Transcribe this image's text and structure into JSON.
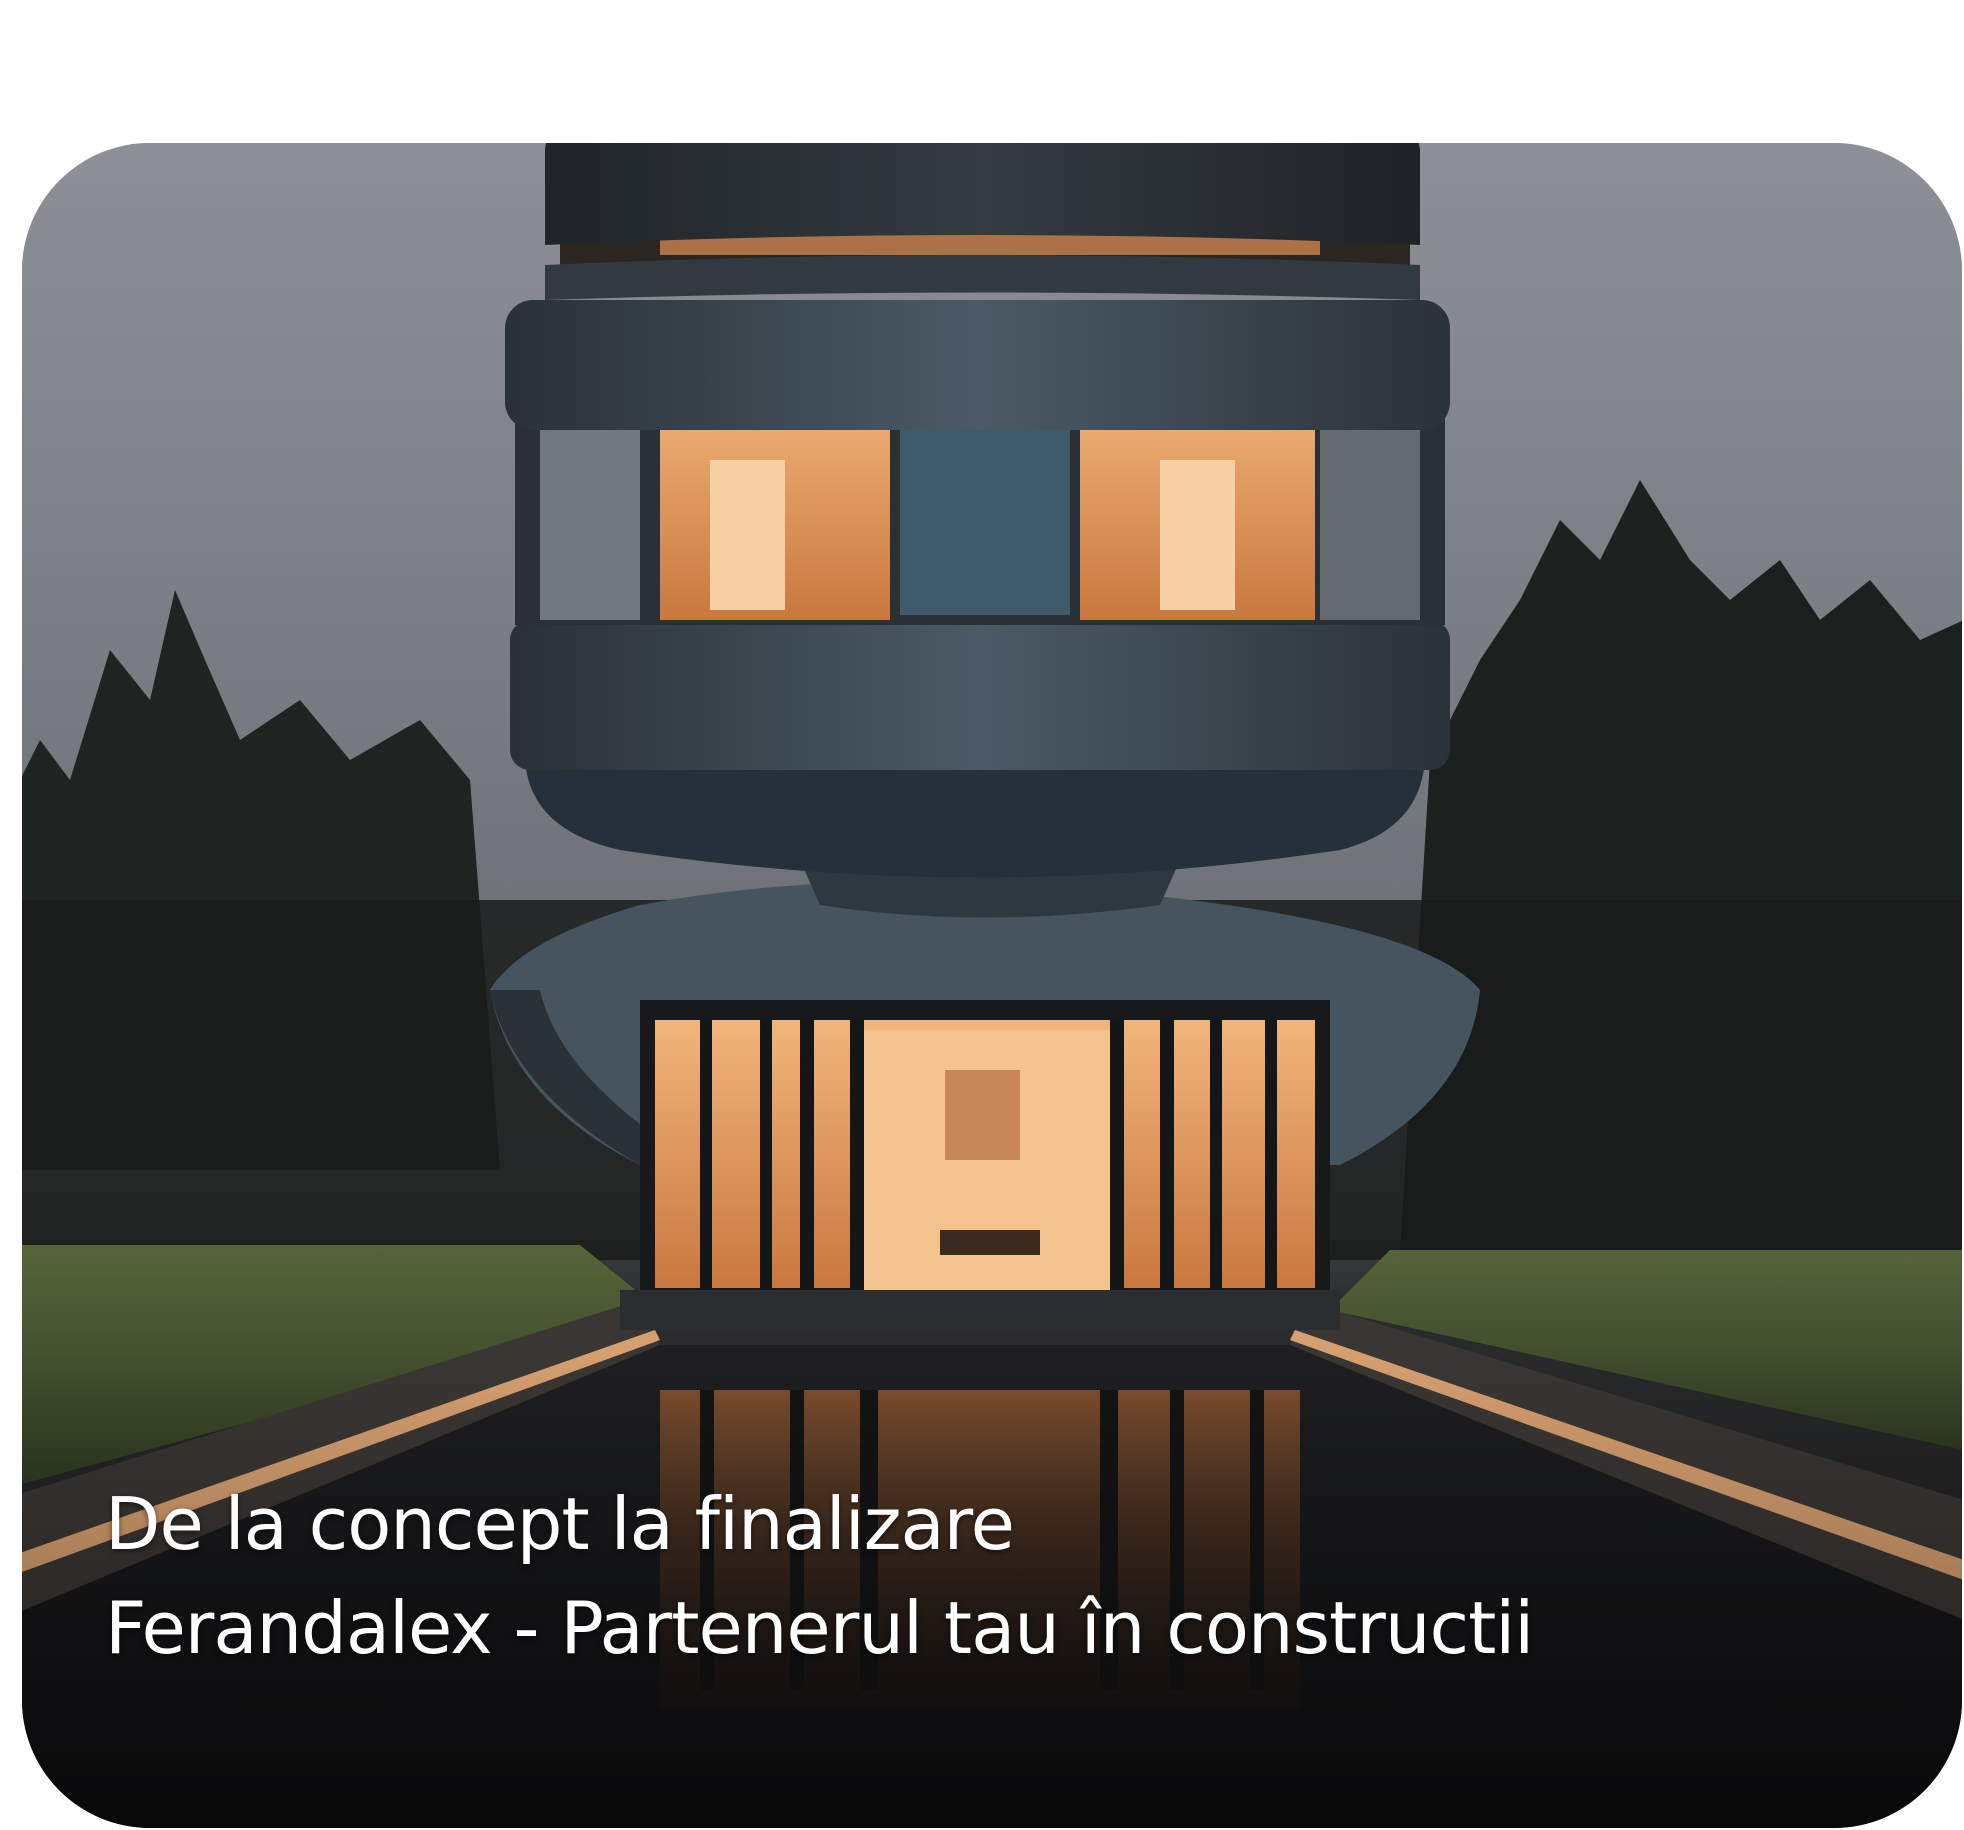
{
  "hero": {
    "caption_line_1": "De la concept la finalizare",
    "caption_line_2": "Ferandalex - Partenerul tau în constructii"
  },
  "colors": {
    "sky": "#82868d",
    "facade": "#3e4b55",
    "window_glow": "#e8a56a",
    "grass": "#4b5a34",
    "water": "#17181a",
    "text": "#ffffff"
  }
}
